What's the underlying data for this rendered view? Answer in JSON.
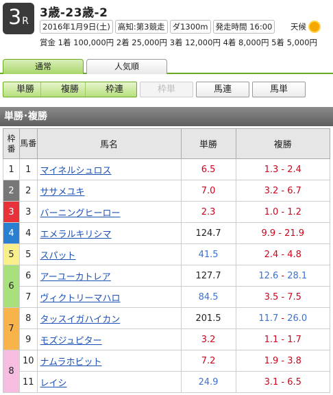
{
  "header": {
    "race_no": "3",
    "race_r": "R",
    "race_name": "3歳-23歳-2",
    "date": "2016年1月9日(土)",
    "venue": "高知:第3競走",
    "course": "ダ1300m",
    "post_time": "発走時間 16:00",
    "weather_label": "天候",
    "prize": "賞金 1着 100,000円 2着 25,000円 3着 12,000円 4着 8,000円 5着 5,000円"
  },
  "tabs": [
    {
      "label": "通常"
    },
    {
      "label": "人気順"
    }
  ],
  "bet_tabs": {
    "group": [
      "単勝",
      "複勝",
      "枠連"
    ],
    "waku_tan": "枠単",
    "umaren": "馬連",
    "umatan": "馬単"
  },
  "section_title": "単勝･複勝",
  "table": {
    "headers": {
      "waku": "枠番",
      "uma": "馬番",
      "name": "馬名",
      "win": "単勝",
      "place": "複勝"
    },
    "rows": [
      {
        "waku": "1",
        "no": "1",
        "name": "マイネルシュロス",
        "win": "6.5",
        "place_lo": "1.3",
        "place_hi": "2.4"
      },
      {
        "waku": "2",
        "no": "2",
        "name": "ササメユキ",
        "win": "7.0",
        "place_lo": "3.2",
        "place_hi": "6.7"
      },
      {
        "waku": "3",
        "no": "3",
        "name": "バーニングヒーロー",
        "win": "2.3",
        "place_lo": "1.0",
        "place_hi": "1.2"
      },
      {
        "waku": "4",
        "no": "4",
        "name": "エメラルキリシマ",
        "win": "124.7",
        "place_lo": "9.9",
        "place_hi": "21.9"
      },
      {
        "waku": "5",
        "no": "5",
        "name": "スパット",
        "win": "41.5",
        "place_lo": "2.4",
        "place_hi": "4.8"
      },
      {
        "waku": "6",
        "no": "6",
        "name": "アーユーカトレア",
        "win": "127.7",
        "place_lo": "12.6",
        "place_hi": "28.1"
      },
      {
        "waku": "",
        "no": "7",
        "name": "ヴィクトリーマハロ",
        "win": "84.5",
        "place_lo": "3.5",
        "place_hi": "7.5"
      },
      {
        "waku": "7",
        "no": "8",
        "name": "タッスイガハイカン",
        "win": "201.5",
        "place_lo": "11.7",
        "place_hi": "26.0"
      },
      {
        "waku": "",
        "no": "9",
        "name": "モズジュピター",
        "win": "3.2",
        "place_lo": "1.1",
        "place_hi": "1.7"
      },
      {
        "waku": "8",
        "no": "10",
        "name": "ナムラホビット",
        "win": "7.2",
        "place_lo": "1.9",
        "place_hi": "3.8"
      },
      {
        "waku": "",
        "no": "11",
        "name": "レイシ",
        "win": "24.9",
        "place_lo": "3.1",
        "place_hi": "6.5"
      }
    ]
  },
  "colors": {
    "red_odds": "#d0021b",
    "blue_odds": "#3a6fd8",
    "accent_green": "#6aaa1e",
    "link": "#1a4fb5"
  }
}
